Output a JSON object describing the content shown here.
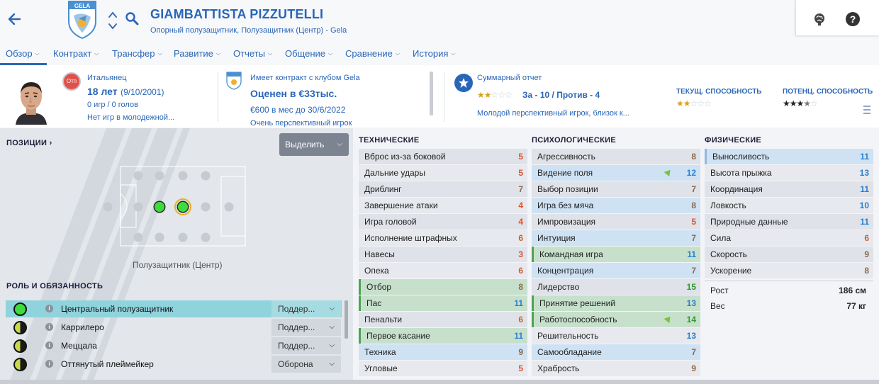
{
  "header": {
    "player_name": "GIAMBATTISTA PIZZUTELLI",
    "player_subtitle": "Опорный полузащитник, Полузащитник (Центр) - Gela",
    "club_crest_text": "GELA"
  },
  "tabs": [
    {
      "label": "Обзор"
    },
    {
      "label": "Контракт"
    },
    {
      "label": "Трансфер"
    },
    {
      "label": "Развитие"
    },
    {
      "label": "Отчеты"
    },
    {
      "label": "Общение"
    },
    {
      "label": "Сравнение"
    },
    {
      "label": "История"
    }
  ],
  "info": {
    "nationality_badge": "Отп",
    "nationality": "Итальянец",
    "age": "18 лет",
    "birthdate": "(9/10/2001)",
    "games": "0 игр / 0 голов",
    "youth": "Нет игр в молодежной...",
    "contract": "Имеет контракт с клубом Gela",
    "value": "Оценен в €33тыс.",
    "wage": "€600 в мес до 30/6/2022",
    "wage_extra": "Очень перспективный игрок",
    "report_title": "Суммарный отчет",
    "pros_cons": "За - 10 / Против - 4",
    "report_summary": "Молодой перспективный игрок, близок к...",
    "ca_label": "ТЕКУЩ. СПОСОБНОСТЬ",
    "pa_label": "ПОТЕНЦ. СПОСОБНОСТЬ",
    "report_stars": 2,
    "ca_stars": 2,
    "pa_stars": 3.5
  },
  "positions": {
    "title": "ПОЗИЦИИ",
    "select_label": "Выделить",
    "position_label": "Полузащитник (Центр)"
  },
  "roles": {
    "title": "РОЛЬ И ОБЯЗАННОСТЬ",
    "items": [
      {
        "name": "Центральный полузащитник",
        "duty": "Поддер...",
        "rating": "green"
      },
      {
        "name": "Каррилеро",
        "duty": "Поддер...",
        "rating": "half"
      },
      {
        "name": "Меццала",
        "duty": "Поддер...",
        "rating": "half"
      },
      {
        "name": "Оттянутый плеймейкер",
        "duty": "Оборона",
        "rating": "half"
      }
    ]
  },
  "technical": {
    "title": "ТЕХНИЧЕСКИЕ",
    "items": [
      {
        "name": "Вброс из-за боковой",
        "value": "5"
      },
      {
        "name": "Дальние удары",
        "value": "5"
      },
      {
        "name": "Дриблинг",
        "value": "7"
      },
      {
        "name": "Завершение атаки",
        "value": "4"
      },
      {
        "name": "Игра головой",
        "value": "4"
      },
      {
        "name": "Исполнение штрафных",
        "value": "6"
      },
      {
        "name": "Навесы",
        "value": "3"
      },
      {
        "name": "Опека",
        "value": "6"
      },
      {
        "name": "Отбор",
        "value": "8"
      },
      {
        "name": "Пас",
        "value": "11"
      },
      {
        "name": "Пенальти",
        "value": "6"
      },
      {
        "name": "Первое касание",
        "value": "11"
      },
      {
        "name": "Техника",
        "value": "9"
      },
      {
        "name": "Угловые",
        "value": "5"
      }
    ]
  },
  "mental": {
    "title": "ПСИХОЛОГИЧЕСКИЕ",
    "items": [
      {
        "name": "Агрессивность",
        "value": "8"
      },
      {
        "name": "Видение поля",
        "value": "12"
      },
      {
        "name": "Выбор позиции",
        "value": "7"
      },
      {
        "name": "Игра без мяча",
        "value": "8"
      },
      {
        "name": "Импровизация",
        "value": "5"
      },
      {
        "name": "Интуиция",
        "value": "7"
      },
      {
        "name": "Командная игра",
        "value": "11"
      },
      {
        "name": "Концентрация",
        "value": "7"
      },
      {
        "name": "Лидерство",
        "value": "15"
      },
      {
        "name": "Принятие решений",
        "value": "13"
      },
      {
        "name": "Работоспособность",
        "value": "14"
      },
      {
        "name": "Решительность",
        "value": "13"
      },
      {
        "name": "Самообладание",
        "value": "7"
      },
      {
        "name": "Храбрость",
        "value": "9"
      }
    ]
  },
  "physical": {
    "title": "ФИЗИЧЕСКИЕ",
    "items": [
      {
        "name": "Выносливость",
        "value": "11"
      },
      {
        "name": "Высота прыжка",
        "value": "13"
      },
      {
        "name": "Координация",
        "value": "11"
      },
      {
        "name": "Ловкость",
        "value": "10"
      },
      {
        "name": "Природные данные",
        "value": "11"
      },
      {
        "name": "Сила",
        "value": "6"
      },
      {
        "name": "Скорость",
        "value": "9"
      },
      {
        "name": "Ускорение",
        "value": "8"
      }
    ],
    "height_label": "Рост",
    "height_value": "186 см",
    "weight_label": "Вес",
    "weight_value": "77 кг"
  }
}
